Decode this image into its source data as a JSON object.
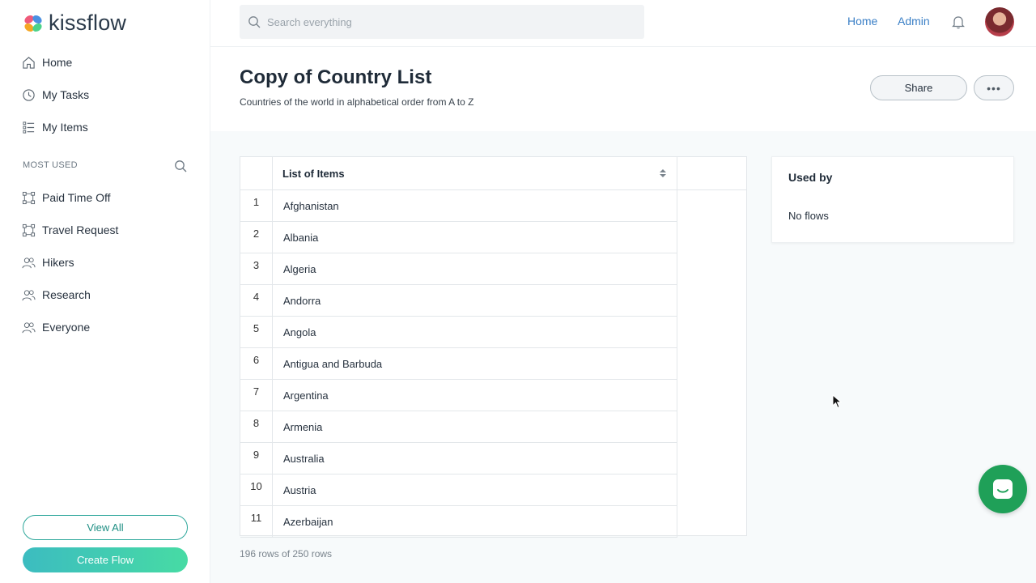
{
  "app": {
    "logo_text": "kissflow"
  },
  "sidebar": {
    "nav": [
      {
        "label": "Home",
        "icon": "home-icon"
      },
      {
        "label": "My Tasks",
        "icon": "clock-icon"
      },
      {
        "label": "My Items",
        "icon": "list-icon"
      }
    ],
    "section_label": "MOST USED",
    "most_used": [
      {
        "label": "Paid Time Off",
        "icon": "flow-icon"
      },
      {
        "label": "Travel Request",
        "icon": "flow-icon"
      },
      {
        "label": "Hikers",
        "icon": "group-icon"
      },
      {
        "label": "Research",
        "icon": "group-icon"
      },
      {
        "label": "Everyone",
        "icon": "group-icon"
      }
    ],
    "view_all_label": "View All",
    "create_flow_label": "Create Flow"
  },
  "topbar": {
    "search_placeholder": "Search everything",
    "links": [
      "Home",
      "Admin"
    ]
  },
  "header": {
    "title": "Copy of Country List",
    "description": "Countries of the world in alphabetical order from A to Z",
    "share_label": "Share",
    "more_label": "•••"
  },
  "table": {
    "column_header": "List of Items",
    "rows": [
      {
        "index": "1",
        "value": "Afghanistan"
      },
      {
        "index": "2",
        "value": "Albania"
      },
      {
        "index": "3",
        "value": "Algeria"
      },
      {
        "index": "4",
        "value": "Andorra"
      },
      {
        "index": "5",
        "value": "Angola"
      },
      {
        "index": "6",
        "value": "Antigua and Barbuda"
      },
      {
        "index": "7",
        "value": "Argentina"
      },
      {
        "index": "8",
        "value": "Armenia"
      },
      {
        "index": "9",
        "value": "Australia"
      },
      {
        "index": "10",
        "value": "Austria"
      },
      {
        "index": "11",
        "value": "Azerbaijan"
      }
    ],
    "footer": "196 rows of 250 rows"
  },
  "used_by": {
    "title": "Used by",
    "text": "No flows"
  },
  "colors": {
    "accent_teal": "#2ea79b",
    "link_blue": "#3a7fc6",
    "chat_green": "#1fa058"
  }
}
